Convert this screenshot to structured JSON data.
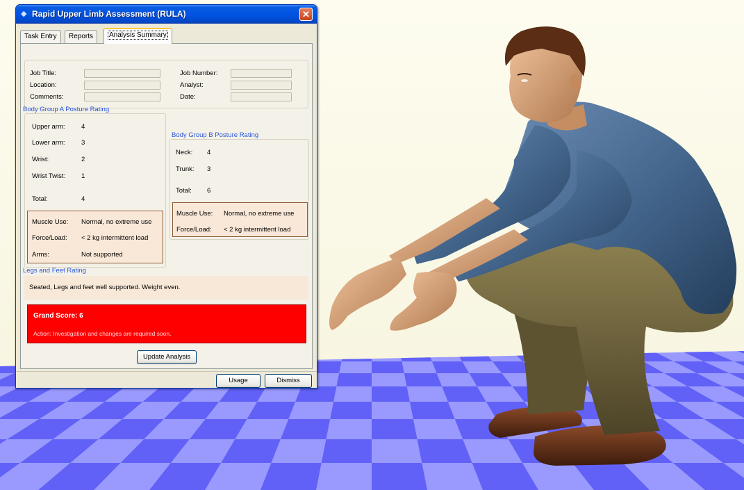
{
  "window": {
    "title": "Rapid Upper Limb Assessment (RULA)",
    "close_symbol": "✕"
  },
  "tabs": [
    {
      "label": "Task Entry",
      "active": false
    },
    {
      "label": "Reports",
      "active": false
    },
    {
      "label": "Analysis Summary",
      "active": true
    }
  ],
  "job_info": {
    "job_title_label": "Job Title:",
    "location_label": "Location:",
    "comments_label": "Comments:",
    "job_number_label": "Job Number:",
    "analyst_label": "Analyst:",
    "date_label": "Date:",
    "job_title_value": "",
    "location_value": "",
    "comments_value": "",
    "job_number_value": "",
    "analyst_value": "",
    "date_value": ""
  },
  "group_a": {
    "title": "Body Group A Posture Rating",
    "upper_arm_label": "Upper arm:",
    "upper_arm_value": "4",
    "lower_arm_label": "Lower arm:",
    "lower_arm_value": "3",
    "wrist_label": "Wrist:",
    "wrist_value": "2",
    "wrist_twist_label": "Wrist Twist:",
    "wrist_twist_value": "1",
    "total_label": "Total:",
    "total_value": "4",
    "muscle_use_label": "Muscle Use:",
    "muscle_use_value": "Normal, no extreme use",
    "force_load_label": "Force/Load:",
    "force_load_value": "< 2 kg intermittent load",
    "arms_label": "Arms:",
    "arms_value": "Not supported"
  },
  "group_b": {
    "title": "Body Group B Posture Rating",
    "neck_label": "Neck:",
    "neck_value": "4",
    "trunk_label": "Trunk:",
    "trunk_value": "3",
    "total_label": "Total:",
    "total_value": "6",
    "muscle_use_label": "Muscle Use:",
    "muscle_use_value": "Normal, no extreme use",
    "force_load_label": "Force/Load:",
    "force_load_value": "< 2 kg intermittent load"
  },
  "legs": {
    "title": "Legs and Feet Rating",
    "value": "Seated, Legs and feet well supported.  Weight even."
  },
  "grand_score": {
    "title": "Grand Score: 6",
    "action": "Action:  Investigation and changes are required soon."
  },
  "buttons": {
    "update_analysis": "Update Analysis",
    "usage": "Usage",
    "dismiss": "Dismiss"
  },
  "colors": {
    "grand_score_bg": "#ff0000",
    "group_title": "#2a55d8",
    "floor_light": "#9a9afe",
    "floor_dark": "#6161f7",
    "background": "#fcfbe6",
    "shirt": "#46688f",
    "pants": "#6b5f38"
  },
  "scene": {
    "description_icons": [
      "checkerboard-floor",
      "squatting-human-figure"
    ]
  }
}
